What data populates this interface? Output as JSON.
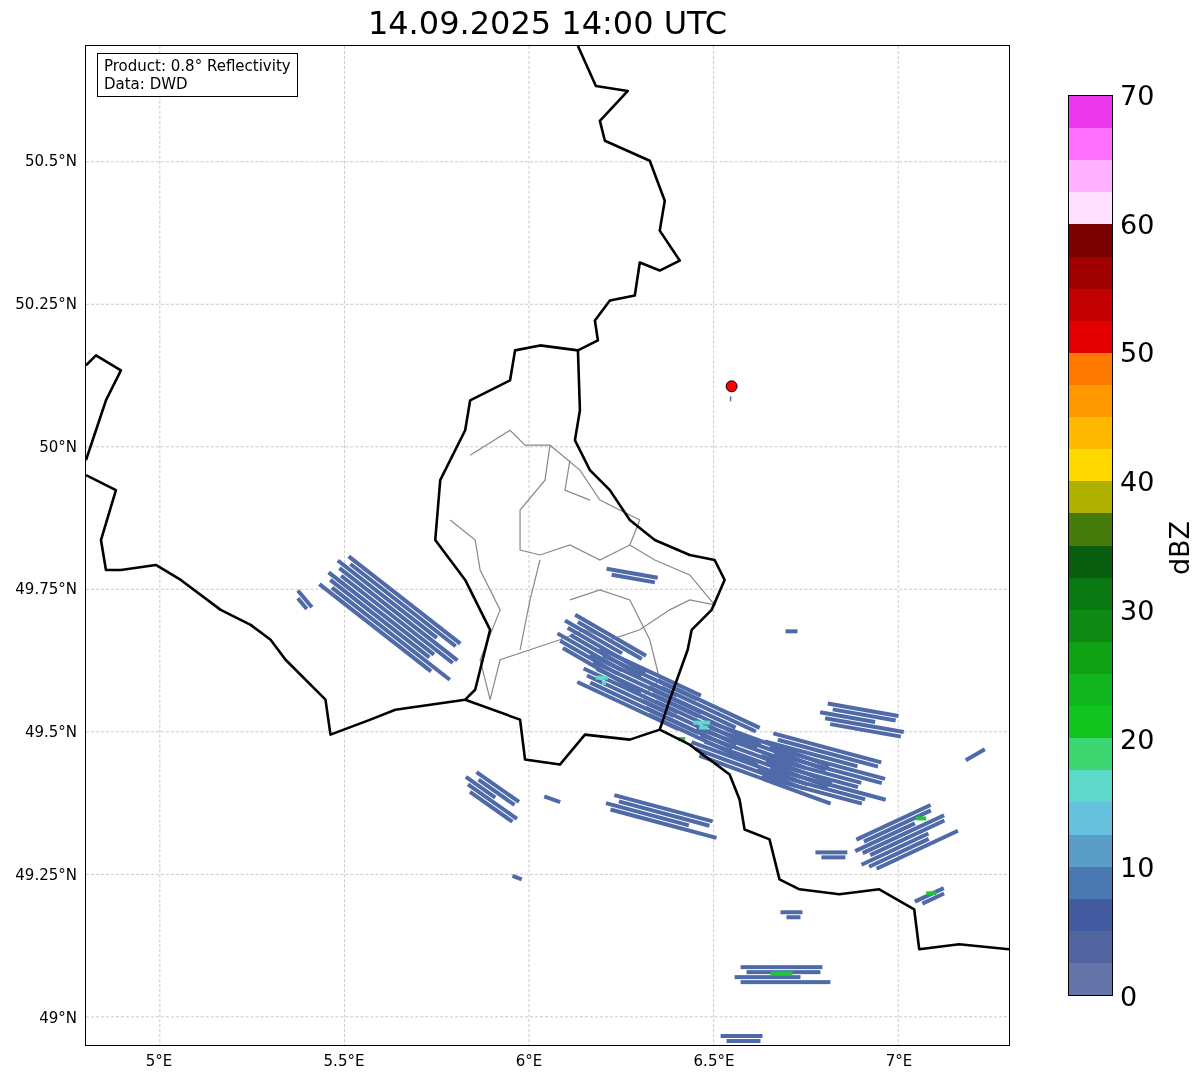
{
  "title": "14.09.2025 14:00 UTC",
  "info_box": [
    "Product: 0.8° Reflectivity",
    "Data: DWD"
  ],
  "map": {
    "lat_labels": [
      "50.5°N",
      "50.25°N",
      "50°N",
      "49.75°N",
      "49.5°N",
      "49.25°N",
      "49°N"
    ],
    "lon_labels": [
      "5°E",
      "5.5°E",
      "6°E",
      "6.5°E",
      "7°E"
    ]
  },
  "colorbar": {
    "label": "dBZ",
    "ticks": [
      "70",
      "60",
      "50",
      "40",
      "30",
      "20",
      "10",
      "0"
    ],
    "segments": [
      {
        "color": "#ea38ea"
      },
      {
        "color": "#ff70ff"
      },
      {
        "color": "#ffb0ff"
      },
      {
        "color": "#ffe0ff"
      },
      {
        "color": "#7a0000"
      },
      {
        "color": "#a00000"
      },
      {
        "color": "#c20000"
      },
      {
        "color": "#e40000"
      },
      {
        "color": "#ff7800"
      },
      {
        "color": "#ff9800"
      },
      {
        "color": "#ffb800"
      },
      {
        "color": "#ffd800"
      },
      {
        "color": "#b0b000"
      },
      {
        "color": "#467a0a"
      },
      {
        "color": "#085e0e"
      },
      {
        "color": "#0a7812"
      },
      {
        "color": "#0e8a14"
      },
      {
        "color": "#10a214"
      },
      {
        "color": "#10b41c"
      },
      {
        "color": "#12c41e"
      },
      {
        "color": "#3ed670"
      },
      {
        "color": "#5ed8c8"
      },
      {
        "color": "#66c2dc"
      },
      {
        "color": "#5a9ec8"
      },
      {
        "color": "#4a78b0"
      },
      {
        "color": "#425aa0"
      },
      {
        "color": "#5265a0"
      },
      {
        "color": "#6474a8"
      }
    ]
  }
}
